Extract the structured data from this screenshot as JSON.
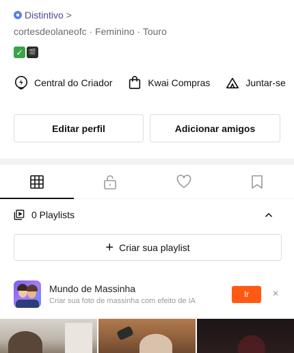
{
  "profile": {
    "badge_label": "Distintivo",
    "badge_chevron": ">",
    "meta": "cortesdeolaneofc · Feminino · Touro",
    "emojis": [
      "✓",
      "🎬"
    ]
  },
  "shortcuts": [
    {
      "label": "Central do Criador",
      "icon": "lightning-icon"
    },
    {
      "label": "Kwai Compras",
      "icon": "shopping-bag-icon"
    },
    {
      "label": "Juntar-se",
      "icon": "tent-icon"
    }
  ],
  "actions": {
    "edit_profile": "Editar perfil",
    "add_friends": "Adicionar amigos"
  },
  "tabs": [
    {
      "name": "grid",
      "icon": "grid-icon",
      "active": true
    },
    {
      "name": "private",
      "icon": "lock-icon",
      "active": false
    },
    {
      "name": "liked",
      "icon": "heart-icon",
      "active": false
    },
    {
      "name": "saved",
      "icon": "bookmark-icon",
      "active": false
    }
  ],
  "playlists": {
    "count_label": "0 Playlists",
    "create_label": "Criar sua playlist",
    "create_plus": "+"
  },
  "promo": {
    "title": "Mundo de Massinha",
    "subtitle": "Criar sua foto de massinha com efeito de IA",
    "go_label": "Ir",
    "close_glyph": "×"
  },
  "colors": {
    "accent": "#ff5a14",
    "badge": "#5b7bf7"
  }
}
